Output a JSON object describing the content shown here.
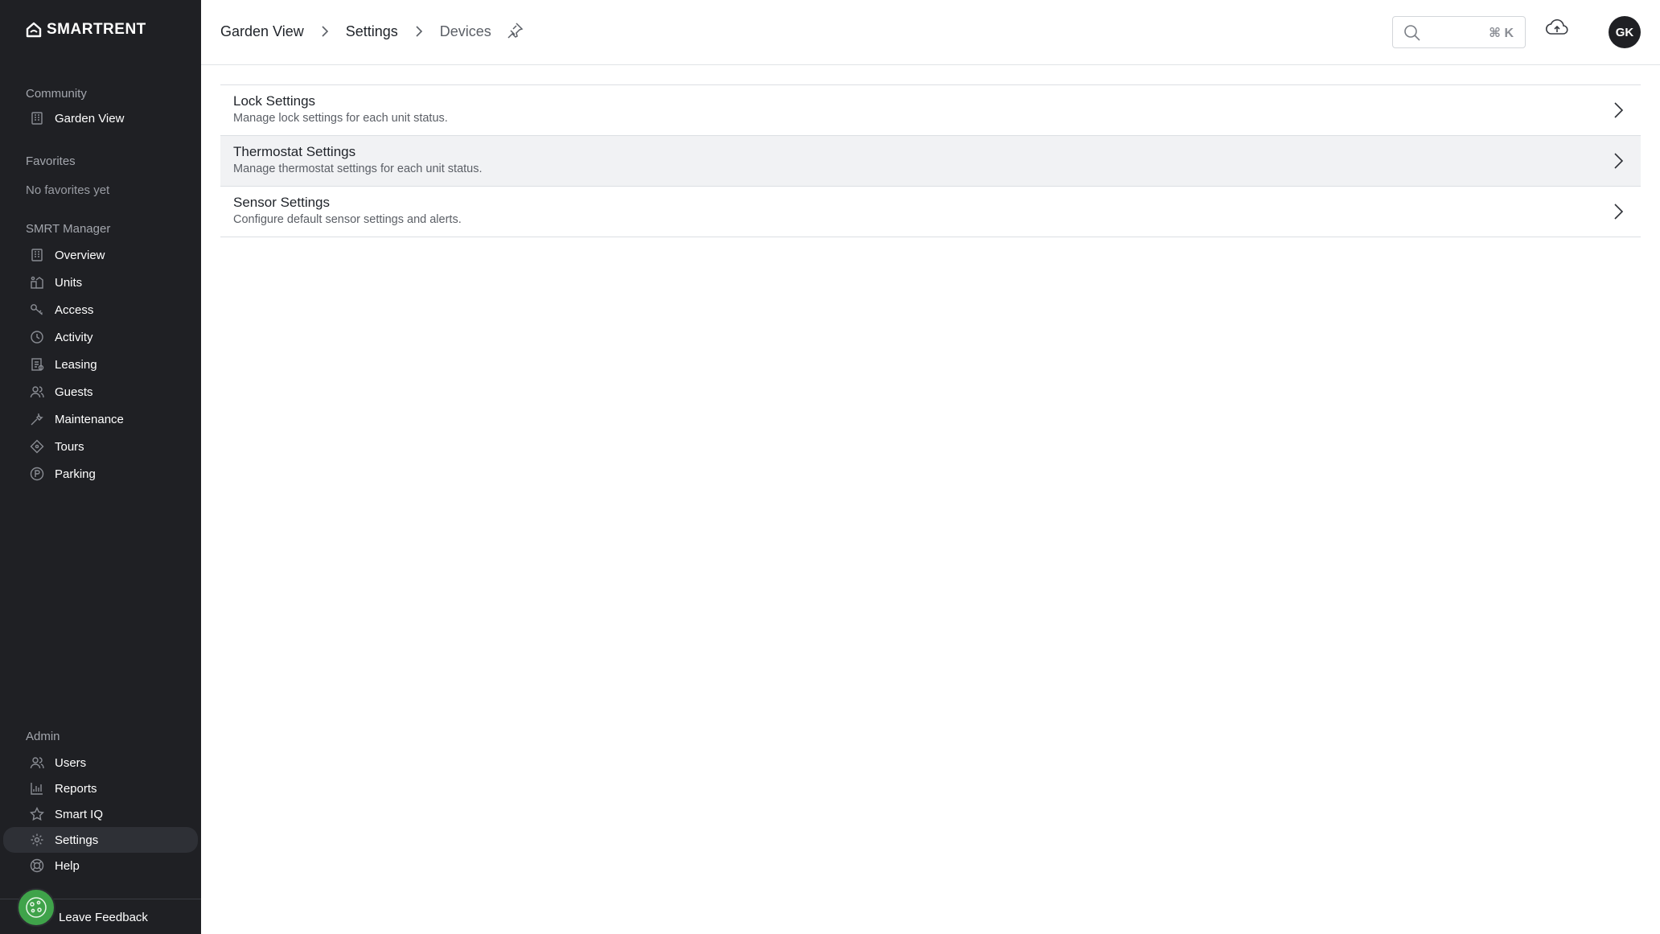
{
  "app": {
    "brand": "SMARTRENT"
  },
  "sidebar": {
    "community_label": "Community",
    "community_item": "Garden View",
    "favorites_label": "Favorites",
    "favorites_empty": "No favorites yet",
    "manager_label": "SMRT Manager",
    "manager_items": [
      {
        "label": "Overview",
        "icon": "building-icon"
      },
      {
        "label": "Units",
        "icon": "units-icon"
      },
      {
        "label": "Access",
        "icon": "key-icon"
      },
      {
        "label": "Activity",
        "icon": "clock-icon"
      },
      {
        "label": "Leasing",
        "icon": "leasing-icon"
      },
      {
        "label": "Guests",
        "icon": "guests-icon"
      },
      {
        "label": "Maintenance",
        "icon": "wrench-icon"
      },
      {
        "label": "Tours",
        "icon": "tour-tag-icon"
      },
      {
        "label": "Parking",
        "icon": "parking-icon"
      }
    ],
    "admin_label": "Admin",
    "admin_items": [
      {
        "label": "Users",
        "icon": "users-icon"
      },
      {
        "label": "Reports",
        "icon": "chart-icon"
      },
      {
        "label": "Smart IQ",
        "icon": "star-icon"
      },
      {
        "label": "Settings",
        "icon": "gear-icon",
        "active": true
      },
      {
        "label": "Help",
        "icon": "help-icon"
      }
    ],
    "feedback_label": "Leave Feedback"
  },
  "header": {
    "breadcrumb": [
      "Garden View",
      "Settings",
      "Devices"
    ],
    "search": {
      "value": "",
      "placeholder": "",
      "shortcut": "⌘ K"
    },
    "avatar_initials": "GK"
  },
  "settings": [
    {
      "title": "Lock Settings",
      "description": "Manage lock settings for each unit status."
    },
    {
      "title": "Thermostat Settings",
      "description": "Manage thermostat settings for each unit status."
    },
    {
      "title": "Sensor Settings",
      "description": "Configure default sensor settings and alerts."
    }
  ],
  "colors": {
    "sidebar_bg": "#1f2024",
    "feedback_green": "#3fa34a",
    "row_hover": "#f1f2f4"
  }
}
